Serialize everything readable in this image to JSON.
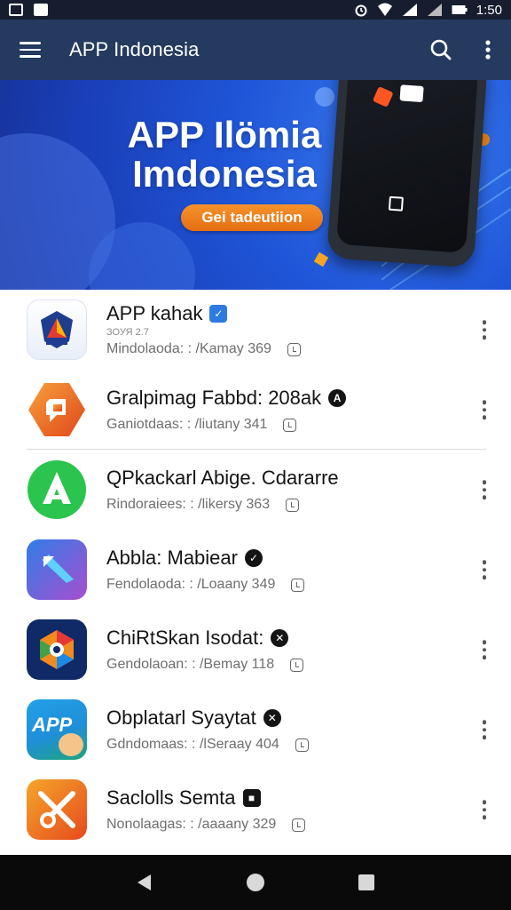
{
  "status_bar": {
    "time": "1:50"
  },
  "app_bar": {
    "title": "APP Indonesia",
    "icons": [
      "menu-icon",
      "search-icon",
      "more-vert-icon"
    ]
  },
  "banner": {
    "title_line1": "APP Ilömia",
    "title_line2": "Imdonesia",
    "cta_label": "Gei tadeutiion"
  },
  "apps": [
    {
      "name": "APP kahak",
      "sub": "ЗОУЯ 2.7",
      "meta": "Mindolaoda: : /Kamay 369",
      "badge": "✓",
      "icon": "shield-app-icon",
      "colors": [
        "#ffffff",
        "#e8eef9"
      ]
    },
    {
      "name": "Gralpimag Fabbd: 208ak",
      "sub": "",
      "meta": "Ganiotdaas: : /liutany 341",
      "badge": "A",
      "icon": "orange-hex-app-icon",
      "colors": [
        "#f7a13c",
        "#e0461a"
      ]
    },
    {
      "name": "QPkackarl Abige. Cdararre",
      "sub": "",
      "meta": "Rindoraiees: : /likersy 363",
      "badge": "",
      "icon": "green-a-app-icon",
      "colors": [
        "#3ad35a",
        "#17a640"
      ]
    },
    {
      "name": "Abbla: Mabiear",
      "sub": "",
      "meta": "Fendolaoda: : /Loaany 349",
      "badge": "✓",
      "icon": "purple-arrow-app-icon",
      "colors": [
        "#2f7ee8",
        "#a84ecf"
      ]
    },
    {
      "name": "ChiRtSkan Isodat:",
      "sub": "",
      "meta": "Gendolaoan: : /Bemay 118",
      "badge": "✕",
      "icon": "camera-app-icon",
      "colors": [
        "#163c8c",
        "#0b1e4f"
      ]
    },
    {
      "name": "Obplatarl Syaytat",
      "sub": "",
      "meta": "Gdndomaas: : /lSeraay 404",
      "badge": "✕",
      "icon": "app-text-app-icon",
      "icon_text": "APP",
      "colors": [
        "#23a0e8",
        "#1fa57a"
      ]
    },
    {
      "name": "Saclolls Semta",
      "sub": "",
      "meta": "Nonolaagas: : /aaaany 329",
      "badge": "■",
      "icon": "orange-scissors-app-icon",
      "colors": [
        "#f5a629",
        "#e64a1e"
      ]
    }
  ],
  "nav_bar": {
    "icons": [
      "back-icon",
      "home-icon",
      "recents-icon"
    ]
  }
}
